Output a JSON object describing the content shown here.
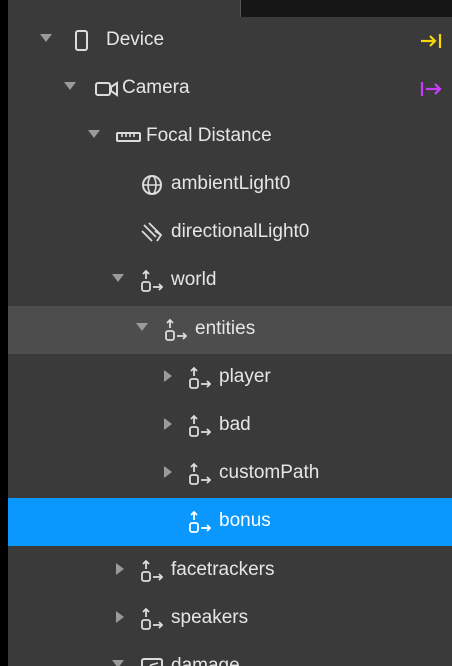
{
  "colors": {
    "panel_bg": "#3a3a3a",
    "row_highlight": "#4d4d4d",
    "row_selected": "#0a98ff",
    "text": "#e6e6e6",
    "device_action": "#f5d60a",
    "camera_action": "#c93cff"
  },
  "tree": {
    "device": {
      "label": "Device",
      "icon": "device-icon",
      "action_icon": "dock-right-icon"
    },
    "camera": {
      "label": "Camera",
      "icon": "camera-icon",
      "action_icon": "arrow-right-bar-icon"
    },
    "focal_distance": {
      "label": "Focal Distance",
      "icon": "ruler-icon"
    },
    "ambient_light": {
      "label": "ambientLight0",
      "icon": "globe-icon"
    },
    "directional_light": {
      "label": "directionalLight0",
      "icon": "directional-light-icon"
    },
    "world": {
      "label": "world",
      "icon": "null-object-icon"
    },
    "entities": {
      "label": "entities",
      "icon": "null-object-icon"
    },
    "player": {
      "label": "player",
      "icon": "null-object-icon"
    },
    "bad": {
      "label": "bad",
      "icon": "null-object-icon"
    },
    "custom_path": {
      "label": "customPath",
      "icon": "null-object-icon"
    },
    "bonus": {
      "label": "bonus",
      "icon": "null-object-icon"
    },
    "facetrackers": {
      "label": "facetrackers",
      "icon": "null-object-icon"
    },
    "speakers": {
      "label": "speakers",
      "icon": "null-object-icon"
    },
    "damage": {
      "label": "damage",
      "icon": "canvas-icon"
    }
  }
}
